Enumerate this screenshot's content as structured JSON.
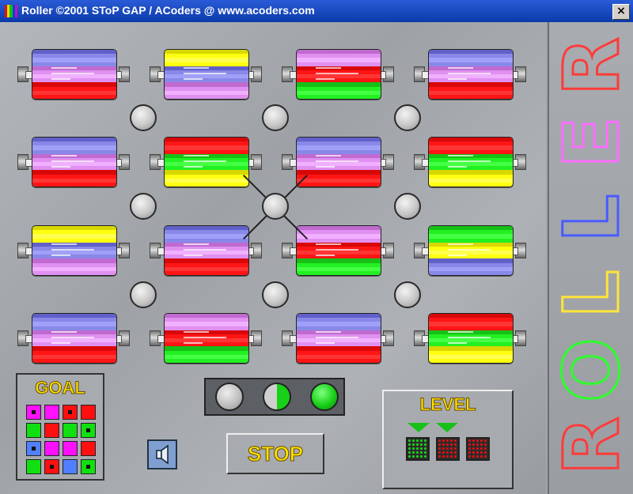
{
  "window": {
    "title": "Roller ©2001 SToP GAP / ACoders @ www.acoders.com",
    "close_label": "×",
    "icon_colors": [
      "#e01010",
      "#e0e010",
      "#10c010",
      "#1040e0",
      "#c010c0"
    ]
  },
  "colors": {
    "red": [
      "#8a0a0a",
      "#d80808",
      "#ff1515",
      "#ff3535",
      "#d80808",
      "#8a0a0a"
    ],
    "green": [
      "#0a6a0a",
      "#16c016",
      "#22f022",
      "#44ff44",
      "#16c016",
      "#0a6a0a"
    ],
    "yellow": [
      "#8a8a00",
      "#d8d800",
      "#ffff10",
      "#ffff50",
      "#d8d800",
      "#8a8a00"
    ],
    "magenta": [
      "#7a2a8a",
      "#c06ad0",
      "#e090f0",
      "#f0b0ff",
      "#c06ad0",
      "#7a2a8a"
    ],
    "blue": [
      "#2a2a8a",
      "#6060c8",
      "#8888e8",
      "#a0a0f8",
      "#6060c8",
      "#2a2a8a"
    ]
  },
  "rollers": [
    [
      "blue-magenta-red",
      "yellow-blue-magenta",
      "magenta-red-green",
      "blue-magenta-red"
    ],
    [
      "blue-magenta-red",
      "red-green-yellow",
      "blue-magenta-red",
      "red-green-yellow"
    ],
    [
      "yellow-blue-magenta",
      "blue-magenta-red",
      "magenta-red-green",
      "green-yellow-blue"
    ],
    [
      "blue-magenta-red",
      "magenta-red-green",
      "blue-magenta-red",
      "red-green-yellow"
    ]
  ],
  "goal": {
    "label": "GOAL",
    "grid": [
      [
        {
          "c": "magenta",
          "dot": true
        },
        {
          "c": "magenta",
          "dot": false
        },
        {
          "c": "red",
          "dot": true
        },
        {
          "c": "red",
          "dot": false
        }
      ],
      [
        {
          "c": "green",
          "dot": false
        },
        {
          "c": "red",
          "dot": false
        },
        {
          "c": "green",
          "dot": false
        },
        {
          "c": "green",
          "dot": true
        }
      ],
      [
        {
          "c": "blue",
          "dot": true
        },
        {
          "c": "magenta",
          "dot": false
        },
        {
          "c": "magenta",
          "dot": false
        },
        {
          "c": "red",
          "dot": false
        }
      ],
      [
        {
          "c": "green",
          "dot": false
        },
        {
          "c": "red",
          "dot": true
        },
        {
          "c": "blue",
          "dot": false
        },
        {
          "c": "green",
          "dot": true
        }
      ]
    ]
  },
  "lights": [
    "off",
    "half",
    "on"
  ],
  "stop_label": "STOP",
  "level": {
    "label": "LEVEL",
    "markers": 2,
    "icons": [
      "green",
      "red",
      "red"
    ]
  },
  "side_letters": [
    {
      "ch": "R",
      "color": "#ff3b3b"
    },
    {
      "ch": "E",
      "color": "#ff6cff"
    },
    {
      "ch": "L",
      "color": "#4a5cff"
    },
    {
      "ch": "L",
      "color": "#ffe43b"
    },
    {
      "ch": "O",
      "color": "#2eff2e"
    },
    {
      "ch": "R",
      "color": "#ff3b3b"
    }
  ]
}
